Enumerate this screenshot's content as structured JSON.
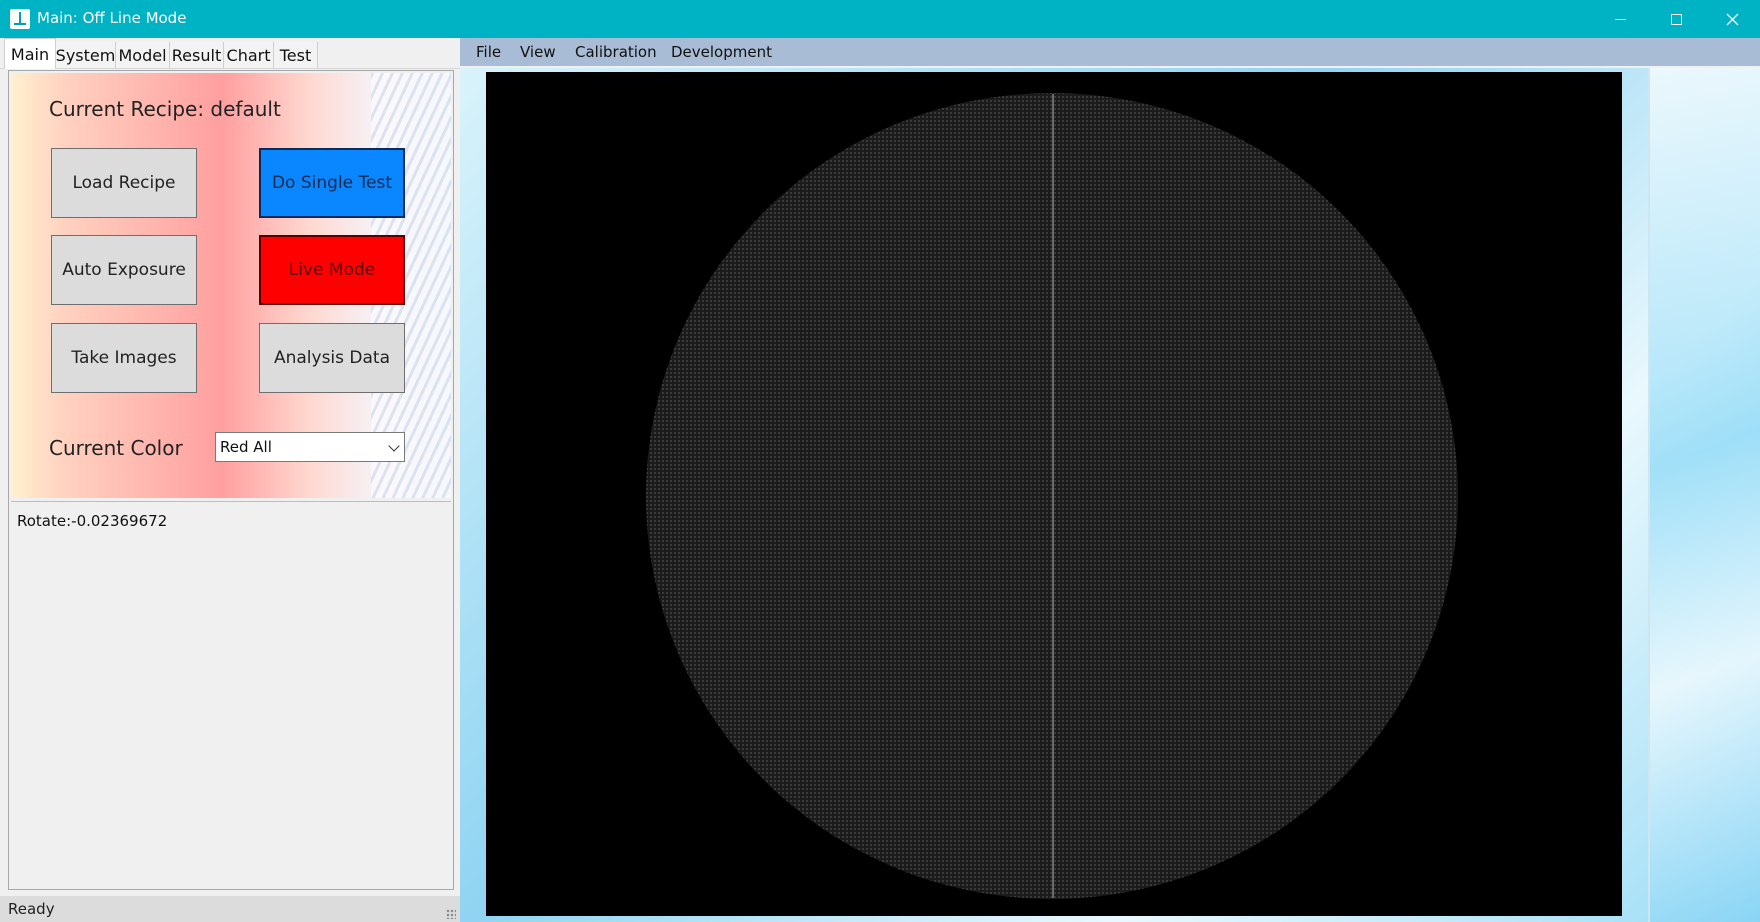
{
  "window": {
    "title": "Main: Off Line Mode",
    "controls": {
      "minimize": "minimize-icon",
      "maximize": "maximize-icon",
      "close": "close-icon"
    }
  },
  "tabs": [
    {
      "label": "Main",
      "active": true
    },
    {
      "label": "System",
      "active": false
    },
    {
      "label": "Model",
      "active": false
    },
    {
      "label": "Result",
      "active": false
    },
    {
      "label": "Chart",
      "active": false
    },
    {
      "label": "Test",
      "active": false
    }
  ],
  "main_panel": {
    "recipe_label": "Current Recipe: default",
    "buttons": {
      "load_recipe": "Load Recipe",
      "do_single_test": "Do Single Test",
      "auto_exposure": "Auto Exposure",
      "live_mode": "Live Mode",
      "take_images": "Take Images",
      "analysis_data": "Analysis Data"
    },
    "color_label": "Current Color",
    "color_select": {
      "value": "Red All"
    },
    "log_text": "Rotate:-0.02369672"
  },
  "menu": [
    "File",
    "View",
    "Calibration",
    "Development"
  ],
  "status": {
    "text": "Ready"
  },
  "colors": {
    "titlebar": "#00b3c4",
    "do_single_test_button": "#0a86ff",
    "live_mode_button": "#ff0000",
    "menubar": "#a8bcd6",
    "image_background": "#000000"
  }
}
